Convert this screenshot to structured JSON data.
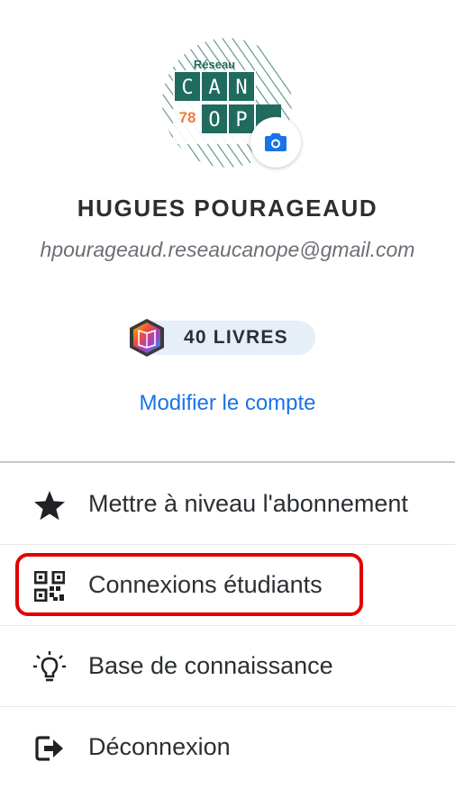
{
  "profile": {
    "name": "HUGUES POURAGEAUD",
    "email": "hpourageaud.reseaucanope@gmail.com",
    "avatar_logo": {
      "top": "Réseau",
      "row1": [
        "C",
        "A",
        "N"
      ],
      "row2_number": "78",
      "row2": [
        "O",
        "P"
      ]
    },
    "camera_icon": "camera-icon"
  },
  "books": {
    "label": "40 LIVRES",
    "icon": "book-creator-logo-icon"
  },
  "edit_account": "Modifier le compte",
  "menu": [
    {
      "label": "Mettre à niveau l'abonnement",
      "icon": "star-icon"
    },
    {
      "label": "Connexions étudiants",
      "icon": "qr-code-icon"
    },
    {
      "label": "Base de connaissance",
      "icon": "lightbulb-icon"
    },
    {
      "label": "Déconnexion",
      "icon": "logout-icon"
    }
  ],
  "colors": {
    "accent_link": "#1a73e8",
    "highlight": "#e00000",
    "logo_teal": "#1f6b5e",
    "logo_orange": "#f07c3a"
  }
}
